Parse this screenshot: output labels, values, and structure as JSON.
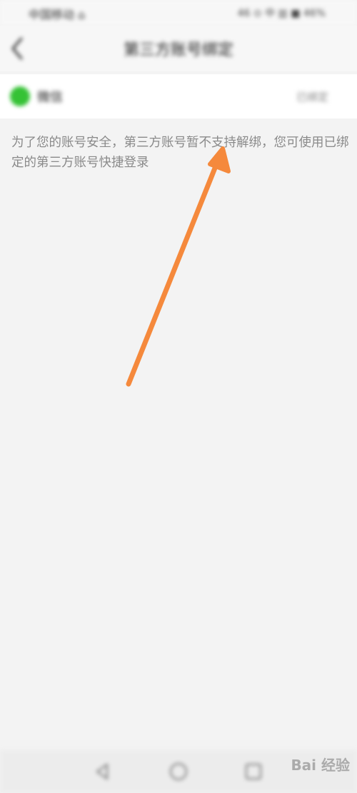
{
  "status_bar": {
    "carrier": "中国移动 ⌂",
    "indicators": "46 ⊙ 中 ▥ ■ 46%"
  },
  "header": {
    "title": "第三方账号绑定",
    "back_icon": "chevron-left-icon"
  },
  "account": {
    "name": "微信",
    "status": "已绑定",
    "icon": "wechat-icon",
    "icon_color": "#35c235"
  },
  "notice_text": "为了您的账号安全，第三方账号暂不支持解绑，您可使用已绑定的第三方账号快捷登录",
  "annotation": {
    "arrow_color": "#f5893c"
  },
  "nav_bar": {
    "keys": [
      "back-triangle-icon",
      "home-circle-icon",
      "recents-square-icon"
    ]
  },
  "watermark": "Bai 经验"
}
